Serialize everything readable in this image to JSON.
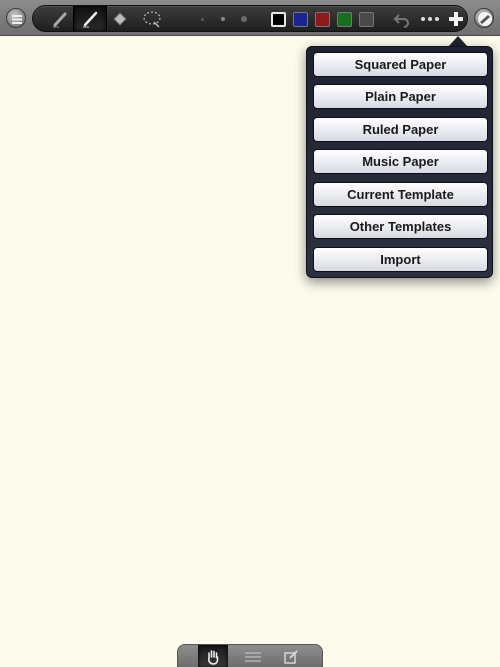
{
  "toolbar": {
    "left_button": {
      "icon": "settings-icon"
    },
    "tools": [
      {
        "name": "highlighter-icon"
      },
      {
        "name": "pen-icon",
        "active": true
      },
      {
        "name": "eraser-icon"
      },
      {
        "name": "lasso-select-icon"
      }
    ],
    "stroke_sizes": [
      "small",
      "medium",
      "large"
    ],
    "selected_stroke": "medium",
    "colors": [
      "#000000",
      "#1b2591",
      "#8c1a1a",
      "#1a6e22",
      "#4a4a4a"
    ],
    "selected_color": "#000000",
    "right_buttons": [
      {
        "icon": "undo-icon"
      },
      {
        "icon": "more-icon"
      },
      {
        "icon": "add-icon"
      }
    ],
    "page_button": {
      "icon": "page-icon"
    }
  },
  "add_menu": {
    "items": [
      "Squared Paper",
      "Plain Paper",
      "Ruled Paper",
      "Music Paper",
      "Current Template",
      "Other Templates",
      "Import"
    ]
  },
  "bottom_bar": {
    "modes": [
      {
        "icon": "hand-icon",
        "active": true
      },
      {
        "icon": "lines-icon"
      },
      {
        "icon": "text-edit-icon"
      }
    ]
  },
  "colors": {
    "paper": "#fdfbec",
    "popover": "#1d2330"
  }
}
